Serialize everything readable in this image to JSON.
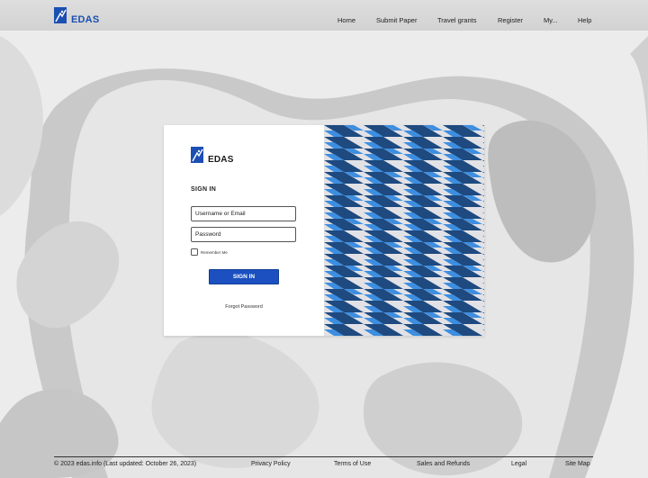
{
  "brand": {
    "name": "EDAS",
    "primary_color": "#1b4fb2"
  },
  "nav": {
    "items": [
      "Home",
      "Submit Paper",
      "Travel grants",
      "Register",
      "My...",
      "Help"
    ]
  },
  "login": {
    "logo_text": "EDAS",
    "title": "SIGN IN",
    "username_placeholder": "Username or Email",
    "password_placeholder": "Password",
    "remember_label": "Remember Me",
    "remember_checked": false,
    "submit_label": "SIGN IN",
    "forgot_label": "Forgot Password",
    "button_color": "#1c50c0"
  },
  "pattern": {
    "colors": [
      "#1e4a80",
      "#3d8ee0",
      "#e2e2e6"
    ]
  },
  "footer": {
    "copyright": "© 2023 edas.info (Last updated: October 26, 2023)",
    "links": [
      "Privacy Policy",
      "Terms of Use",
      "Sales and Refunds",
      "Legal",
      "Site Map"
    ]
  }
}
